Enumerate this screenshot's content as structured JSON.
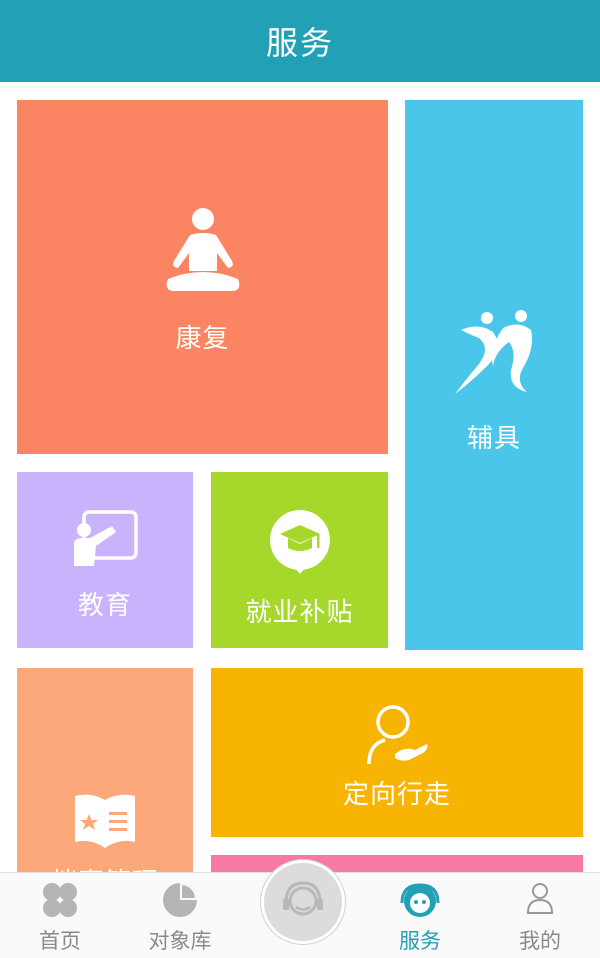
{
  "header": {
    "title": "服务"
  },
  "tiles": {
    "rehab": {
      "label": "康复",
      "color": "#fb8562",
      "icon": "meditation-icon"
    },
    "aids": {
      "label": "辅具",
      "color": "#49c6ea",
      "icon": "dancing-figures-icon"
    },
    "education": {
      "label": "教育",
      "color": "#c9b3fd",
      "icon": "teacher-board-icon"
    },
    "employment": {
      "label": "就业补贴",
      "color": "#a6d72b",
      "icon": "graduation-cap-icon"
    },
    "mobility": {
      "label": "定向行走",
      "color": "#f7b402",
      "icon": "person-helping-hand-icon"
    },
    "archive": {
      "label": "档案管理",
      "color": "#fda87b",
      "icon": "star-book-icon"
    },
    "extra": {
      "color": "#f87aa0"
    }
  },
  "tabbar": {
    "items": [
      {
        "label": "首页",
        "icon": "clover-icon"
      },
      {
        "label": "对象库",
        "icon": "pie-chart-icon"
      },
      {
        "label": "",
        "icon": "headset-service-icon"
      },
      {
        "label": "服务",
        "icon": "service-agent-icon",
        "active": true
      },
      {
        "label": "我的",
        "icon": "user-icon"
      }
    ]
  }
}
